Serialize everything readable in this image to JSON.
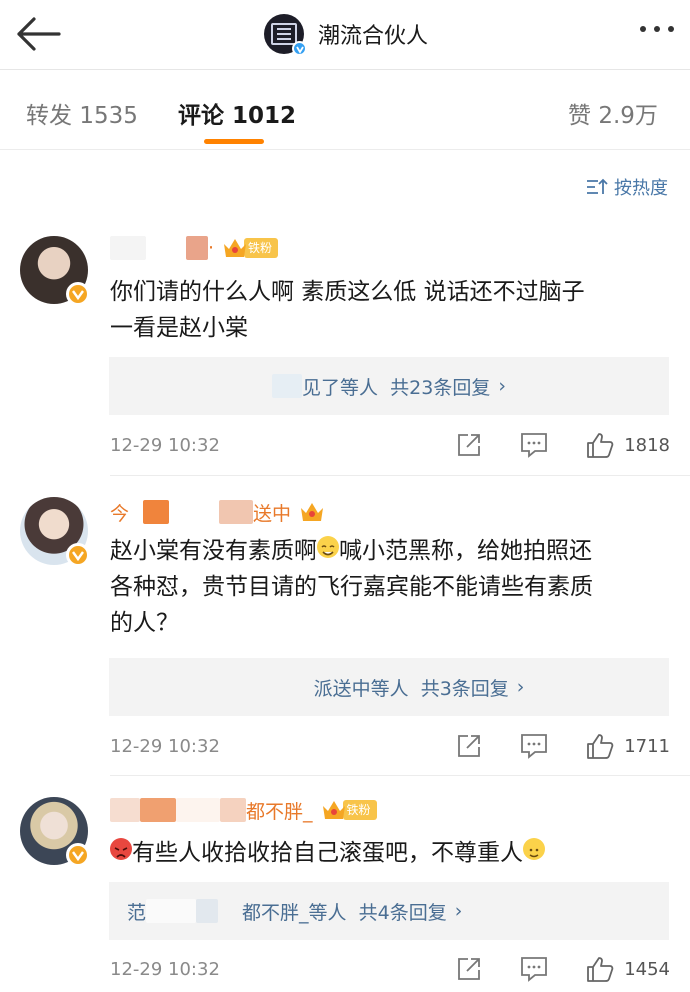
{
  "header": {
    "title": "潮流合伙人",
    "avatar_icon": "brand-logo-icon",
    "verified_badge_color": "#35a0f2"
  },
  "tabs": [
    {
      "label": "转发",
      "count": "1535"
    },
    {
      "label": "评论",
      "count": "1012",
      "active": true
    },
    {
      "label": "赞",
      "count": "2.9万"
    }
  ],
  "accent_color": "#ff8200",
  "sort": {
    "label": "按热度",
    "icon": "sort-icon"
  },
  "comments": [
    {
      "username_suffix": "·",
      "fan_tag": "铁粉",
      "text_line1": "你们请的什么人啊 素质这么低 说话还不过脑子",
      "text_line2": "一看是赵小棠",
      "reply_label": "见了等人",
      "reply_count": "共23条回复",
      "time": "12-29 10:32",
      "likes": "1818"
    },
    {
      "username_prefix": "今",
      "username_suffix": "送中",
      "text_part1": "赵小棠有没有素质啊",
      "text_part2": "喊小范黑称，给她拍照还",
      "text_line2": "各种怼，贵节目请的飞行嘉宾能不能请些有素质",
      "text_line3": "的人？",
      "reply_label": "派送中等人",
      "reply_count": "共3条回复",
      "time": "12-29 10:32",
      "likes": "1711"
    },
    {
      "username_suffix": "都不胖_",
      "fan_tag": "铁粉",
      "text": "有些人收拾收拾自己滚蛋吧，不尊重人",
      "reply_prefix": "范",
      "reply_label": "都不胖_等人",
      "reply_count": "共4条回复",
      "time": "12-29 10:32",
      "likes": "1454"
    }
  ]
}
